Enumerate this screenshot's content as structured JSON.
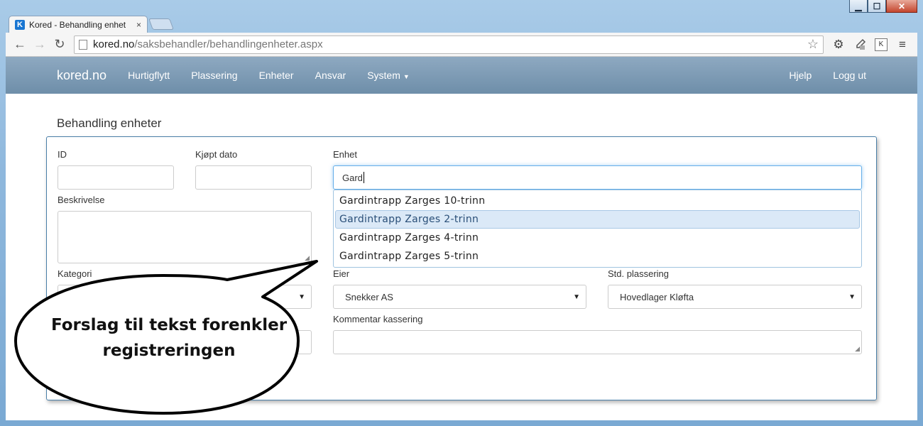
{
  "window": {
    "minimize": "▁",
    "maximize": "☐",
    "close": "✕"
  },
  "tab": {
    "favicon_letter": "K",
    "title": "Kored - Behandling enhet",
    "close": "×"
  },
  "toolbar": {
    "back": "←",
    "forward": "→",
    "reload": "↻",
    "url_host": "kored.no",
    "url_path": "/saksbehandler/behandlingenheter.aspx",
    "star": "☆",
    "settings": "⚙",
    "extension_k": "K",
    "menu": "≡"
  },
  "navbar": {
    "brand": "kored.no",
    "items": [
      "Hurtigflytt",
      "Plassering",
      "Enheter",
      "Ansvar",
      "System"
    ],
    "system_caret": "▼",
    "right_items": [
      "Hjelp",
      "Logg ut"
    ]
  },
  "form": {
    "panel_title": "Behandling enheter",
    "id_label": "ID",
    "id_value": "",
    "kjopt_dato_label": "Kjøpt dato",
    "kjopt_dato_value": "",
    "enhet_label": "Enhet",
    "enhet_value": "Gard",
    "beskrivelse_label": "Beskrivelse",
    "kategori_label": "Kategori",
    "kategori_arrow": "▼",
    "eier_label": "Eier",
    "eier_value": "Snekker AS",
    "std_plassering_label": "Std. plassering",
    "std_plassering_value": "Hovedlager Kløfta",
    "kommentar_label": "Kommentar kassering",
    "select_arrow": "▼",
    "resize_glyph": "◢"
  },
  "autocomplete": {
    "items": [
      "Gardintrapp Zarges 10-trinn",
      "Gardintrapp Zarges 2-trinn",
      "Gardintrapp Zarges 4-trinn",
      "Gardintrapp Zarges 5-trinn"
    ],
    "active_index": 1
  },
  "callout": {
    "line1": "Forslag til tekst forenkler",
    "line2": "registreringen"
  }
}
